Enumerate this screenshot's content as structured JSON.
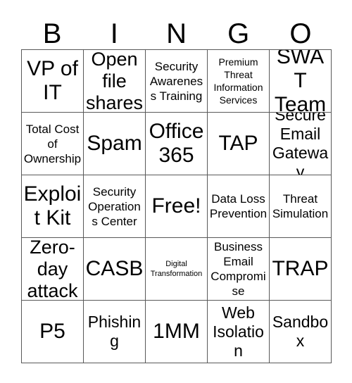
{
  "card": {
    "title": "BINGO",
    "header_letters": [
      "B",
      "I",
      "N",
      "G",
      "O"
    ],
    "free_space_label": "Free!",
    "colors": {
      "background": "#ffffff",
      "text": "#000000",
      "grid_line": "#595959"
    },
    "grid": {
      "columns": 5,
      "rows": 5,
      "cells": [
        {
          "text": "VP of IT",
          "size": "t-xxl"
        },
        {
          "text": "Open file shares",
          "size": "t-xl"
        },
        {
          "text": "Security Awareness Training",
          "size": "t-m"
        },
        {
          "text": "Premium Threat Information Services",
          "size": "t-s"
        },
        {
          "text": "SWAT Team",
          "size": "t-xxl"
        },
        {
          "text": "Total Cost of Ownership",
          "size": "t-m"
        },
        {
          "text": "Spam",
          "size": "t-xxl"
        },
        {
          "text": "Office 365",
          "size": "t-xxl"
        },
        {
          "text": "TAP",
          "size": "t-xxl"
        },
        {
          "text": "Secure Email Gateway",
          "size": "t-l"
        },
        {
          "text": "Exploit Kit",
          "size": "t-xxl"
        },
        {
          "text": "Security Operations Center",
          "size": "t-m"
        },
        {
          "text": "Free!",
          "size": "t-xxl"
        },
        {
          "text": "Data Loss Prevention",
          "size": "t-m"
        },
        {
          "text": "Threat Simulation",
          "size": "t-m"
        },
        {
          "text": "Zero-day attack",
          "size": "t-xl"
        },
        {
          "text": "CASB",
          "size": "t-xxl"
        },
        {
          "text": "Digital Transformation",
          "size": "t-xs"
        },
        {
          "text": "Business Email Compromise",
          "size": "t-m"
        },
        {
          "text": "TRAP",
          "size": "t-xxl"
        },
        {
          "text": "P5",
          "size": "t-xxl"
        },
        {
          "text": "Phishing",
          "size": "t-l"
        },
        {
          "text": "1MM",
          "size": "t-xxl"
        },
        {
          "text": "Web Isolation",
          "size": "t-l"
        },
        {
          "text": "Sandbox",
          "size": "t-l"
        }
      ]
    }
  }
}
